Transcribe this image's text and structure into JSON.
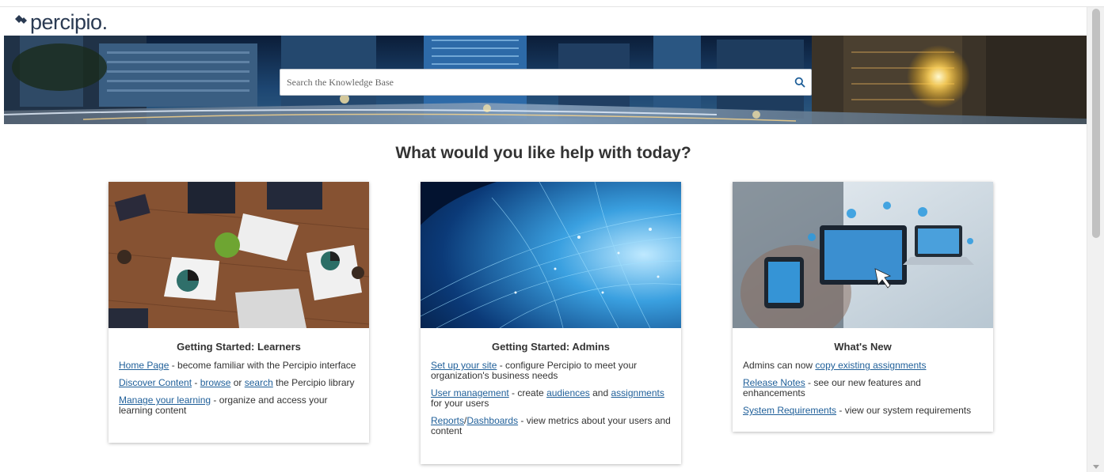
{
  "brand": {
    "name": "percipio",
    "dot": "."
  },
  "search": {
    "placeholder": "Search the Knowledge Base"
  },
  "heading": "What would you like help with today?",
  "cards": {
    "learners": {
      "title": "Getting Started: Learners",
      "items": {
        "home": {
          "link": "Home Page",
          "text": " - become familiar with the Percipio interface"
        },
        "discover": {
          "link": "Discover Content",
          "sep1": " - ",
          "link2": "browse",
          "sep2": " or ",
          "link3": "search",
          "text": " the Percipio library"
        },
        "manage": {
          "link": "Manage your learning",
          "text": " - organize and access your learning content"
        }
      }
    },
    "admins": {
      "title": "Getting Started: Admins",
      "items": {
        "setup": {
          "link": "Set up your site",
          "text": " - configure Percipio to meet your organization's business needs"
        },
        "users": {
          "link": "User management",
          "sep1": " - create ",
          "link2": "audiences",
          "sep2": " and ",
          "link3": "assignments",
          "text": " for your users"
        },
        "reports": {
          "link": "Reports",
          "sep1": "/",
          "link2": "Dashboards",
          "text": " - view metrics about your users and content"
        }
      }
    },
    "new": {
      "title": "What's New",
      "items": {
        "copy": {
          "text": "Admins can now ",
          "link": "copy existing assignments"
        },
        "release": {
          "link": "Release Notes",
          "text": " - see our new features and enhancements"
        },
        "sysreq": {
          "link": "System Requirements",
          "text": " - view our system requirements"
        }
      }
    }
  },
  "colors": {
    "link": "#1f5f99",
    "brand": "#2a3a52",
    "accent": "#3aa0d8"
  }
}
